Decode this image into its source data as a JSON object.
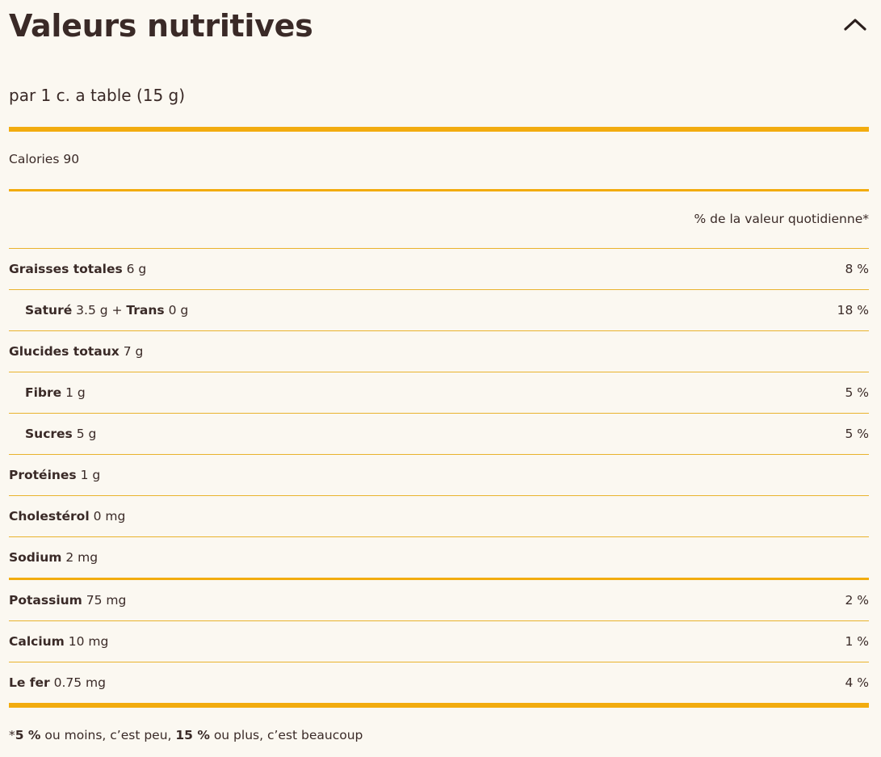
{
  "header": {
    "title": "Valeurs nutritives",
    "collapse_icon": "chevron-up-icon"
  },
  "serving": "par 1 c. a table (15 g)",
  "calories": "Calories 90",
  "dv_header": "% de la valeur quotidienne*",
  "nutrients": [
    {
      "label": "Graisses totales",
      "amount": " 6 g",
      "dv": "8 %"
    },
    {
      "label": "Saturé",
      "amount": " 3.5 g + ",
      "label2": "Trans",
      "amount2": " 0 g",
      "dv": "18 %"
    },
    {
      "label": "Glucides totaux",
      "amount": " 7 g",
      "dv": ""
    },
    {
      "label": "Fibre",
      "amount": " 1 g",
      "dv": "5 %"
    },
    {
      "label": "Sucres",
      "amount": " 5 g",
      "dv": "5 %"
    },
    {
      "label": "Protéines",
      "amount": " 1 g",
      "dv": ""
    },
    {
      "label": "Cholestérol",
      "amount": " 0 mg",
      "dv": ""
    },
    {
      "label": "Sodium",
      "amount": " 2 mg",
      "dv": ""
    }
  ],
  "minerals": [
    {
      "label": "Potassium",
      "amount": " 75 mg",
      "dv": "2 %"
    },
    {
      "label": "Calcium",
      "amount": " 10 mg",
      "dv": "1 %"
    },
    {
      "label": "Le fer",
      "amount": " 0.75 mg",
      "dv": "4 %"
    }
  ],
  "footnote": {
    "prefix": "*",
    "low": "5 %",
    "mid": " ou moins, c’est peu, ",
    "high": "15 %",
    "end": " ou plus, c’est beaucoup"
  },
  "colors": {
    "accent": "#f2ac0f",
    "text": "#3a2a27",
    "background": "#fbf8f1"
  }
}
